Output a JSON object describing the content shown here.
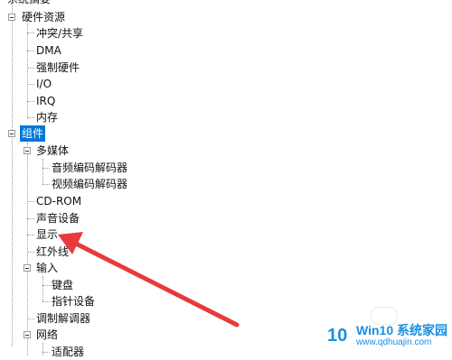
{
  "tree": {
    "header_label": "系统摘要",
    "hardware_resources": {
      "label": "硬件资源",
      "children": [
        "冲突/共享",
        "DMA",
        "强制硬件",
        "I/O",
        "IRQ",
        "内存"
      ]
    },
    "components": {
      "label": "组件",
      "multimedia": {
        "label": "多媒体",
        "children": [
          "音频编码解码器",
          "视频编码解码器"
        ]
      },
      "cd_rom": "CD-ROM",
      "sound_device": "声音设备",
      "display": "显示",
      "infrared": "红外线",
      "input": {
        "label": "输入",
        "children": [
          "键盘",
          "指针设备"
        ]
      },
      "modem": "调制解调器",
      "network": {
        "label": "网络",
        "children": [
          "适配器"
        ]
      }
    }
  },
  "watermark": {
    "logo_text": "10",
    "title": "Win10 系统家园",
    "url": "www.qdhuajin.com"
  },
  "colors": {
    "selection": "#0078d7",
    "annotation_arrow": "#e83a3a",
    "watermark": "#1a8fe0"
  },
  "icons": [
    "collapse-icon",
    "annotation-arrow-icon"
  ]
}
